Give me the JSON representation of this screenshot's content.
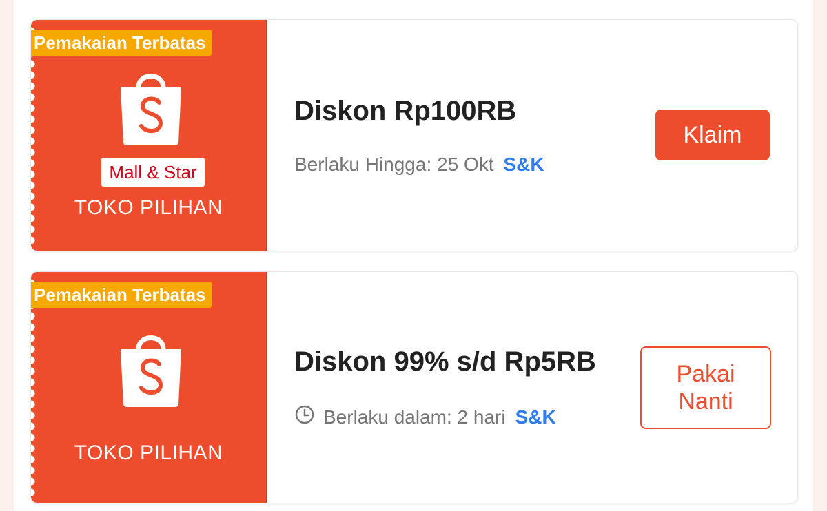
{
  "colors": {
    "brand_orange": "#ee4d2d",
    "tag_yellow": "#f6a700",
    "link_blue": "#2f7cf0",
    "mall_red": "#d0011b"
  },
  "vouchers": [
    {
      "tag": "Pemakaian Terbatas",
      "icon": "shopee-bag-icon",
      "badge": "Mall & Star",
      "store_label": "TOKO PILIHAN",
      "title": "Diskon Rp100RB",
      "validity": "Berlaku Hingga: 25 Okt",
      "terms_link": "S&K",
      "button_label": "Klaim"
    },
    {
      "tag": "Pemakaian Terbatas",
      "icon": "shopee-bag-icon",
      "store_label": "TOKO PILIHAN",
      "title": "Diskon 99% s/d Rp5RB",
      "validity_icon": "clock-icon",
      "validity": "Berlaku dalam: 2 hari",
      "terms_link": "S&K",
      "button_line1": "Pakai",
      "button_line2": "Nanti"
    }
  ]
}
